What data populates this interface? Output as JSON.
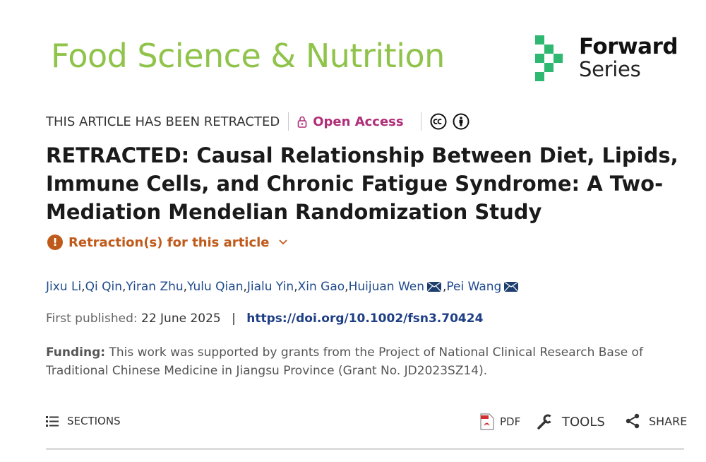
{
  "header": {
    "journal_title": "Food Science & Nutrition",
    "series_logo": {
      "line1": "Forward",
      "line2": "Series"
    }
  },
  "status": {
    "retracted": "THIS ARTICLE HAS BEEN RETRACTED",
    "open_access": "Open Access",
    "license_icons": [
      "cc-icon",
      "by-attribution-icon"
    ]
  },
  "article": {
    "title": "RETRACTED: Causal Relationship Between Diet, Lipids, Immune Cells, and Chronic Fatigue Syndrome: A Two-Mediation Mendelian Randomization Study",
    "retraction_link": "Retraction(s) for this article",
    "authors": [
      "Jixu Li",
      "Qi Qin",
      "Yiran Zhu",
      "Yulu Qian",
      "Jialu Yin",
      "Xin Gao",
      "Huijuan Wen",
      "Pei Wang"
    ],
    "first_published_label": "First published:",
    "first_published_date": "22 June 2025",
    "doi": "https://doi.org/10.1002/fsn3.70424",
    "funding_label": "Funding:",
    "funding_text": "This work was supported by grants from the Project of National Clinical Research Base of Traditional Chinese Medicine in Jiangsu Province (Grant No. JD2023SZ14)."
  },
  "toolbar": {
    "sections": "SECTIONS",
    "pdf": "PDF",
    "tools": "TOOLS",
    "share": "SHARE"
  },
  "colors": {
    "journal_green": "#8fc34a",
    "logo_green": "#2eb872",
    "open_access": "#b02e78",
    "retraction": "#c05a1b",
    "link_blue": "#1e4a8c"
  }
}
